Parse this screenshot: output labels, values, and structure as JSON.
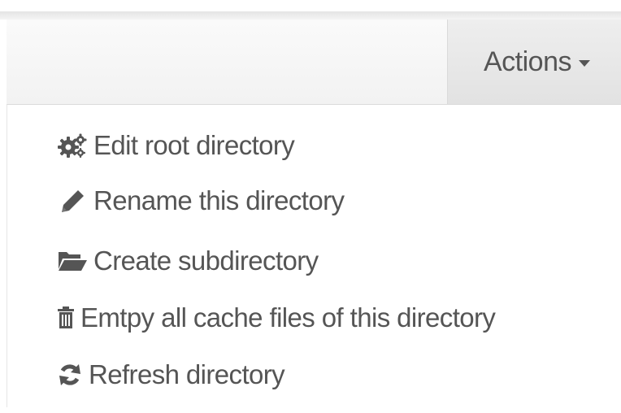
{
  "toolbar": {
    "actions_label": "Actions",
    "caret_icon": "caret-down-icon"
  },
  "menu": {
    "items": [
      {
        "label": "Edit root directory",
        "icon": "cogs-icon"
      },
      {
        "label": "Rename this directory",
        "icon": "pencil-icon"
      },
      {
        "label": "Create subdirectory",
        "icon": "folder-open-icon"
      },
      {
        "label": "Emtpy all cache files of this directory",
        "icon": "trash-icon"
      },
      {
        "label": "Refresh directory",
        "icon": "refresh-icon"
      }
    ]
  },
  "colors": {
    "text": "#555555",
    "navbar": "#f5f5f5",
    "button_active": "#e6e6e6",
    "border": "#dcdcdc"
  }
}
